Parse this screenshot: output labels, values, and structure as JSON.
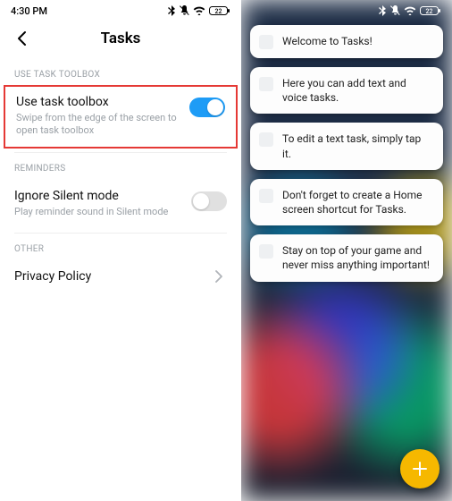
{
  "status": {
    "time": "4:30 PM"
  },
  "left": {
    "title": "Tasks",
    "sections": {
      "toolbox": {
        "label": "USE TASK TOOLBOX",
        "item": {
          "title": "Use task toolbox",
          "sub": "Swipe from the edge of the screen to open task toolbox",
          "on": true
        }
      },
      "reminders": {
        "label": "REMINDERS",
        "item": {
          "title": "Ignore Silent mode",
          "sub": "Play reminder sound in Silent mode",
          "on": false
        }
      },
      "other": {
        "label": "OTHER",
        "item": {
          "title": "Privacy Policy"
        }
      }
    }
  },
  "right": {
    "tasks": [
      "Welcome to Tasks!",
      "Here you can add text and voice tasks.",
      "To edit a text task, simply tap it.",
      "Don't forget to create a Home screen shortcut for Tasks.",
      "Stay on top of your game and never miss anything important!"
    ]
  }
}
